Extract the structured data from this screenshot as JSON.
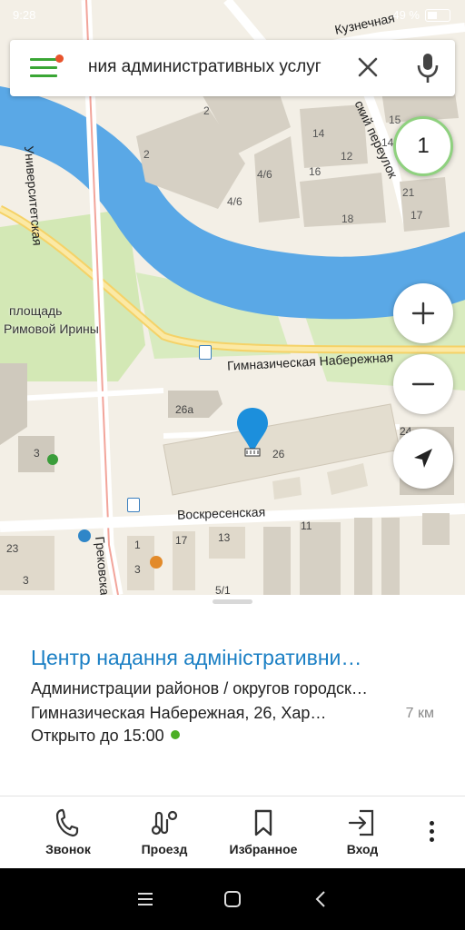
{
  "status_bar": {
    "time": "9:28",
    "battery": "49 %"
  },
  "search": {
    "query": "ния административных услуг"
  },
  "map": {
    "result_count": "1",
    "labels": {
      "square_line1": "площадь",
      "square_line2": "Римовой Ирины",
      "street_university": "Университетская",
      "street_embankment": "Гимназическая Набережная",
      "street_voskresenskaya": "Воскресенская",
      "street_grekovskaya": "Грековская",
      "street_kuznechnaya": "Кузнечная",
      "street_pereulok": "ский переулок",
      "top_partial": "площадь"
    },
    "house_numbers": [
      "2",
      "2",
      "4/6",
      "4/6",
      "16",
      "18",
      "14",
      "12",
      "15",
      "21",
      "17",
      "14",
      "26а",
      "26",
      "3",
      "23",
      "3",
      "1",
      "3",
      "17",
      "13",
      "11",
      "5/1",
      "24"
    ]
  },
  "place": {
    "title": "Центр надання адміністративни…",
    "category": "Администрации районов / округов городск…",
    "address": "Гимназическая Набережная, 26, Хар…",
    "distance": "7 км",
    "hours": "Открыто до 15:00"
  },
  "actions": [
    {
      "label": "Звонок",
      "icon": "phone-icon"
    },
    {
      "label": "Проезд",
      "icon": "route-icon"
    },
    {
      "label": "Избранное",
      "icon": "bookmark-icon"
    },
    {
      "label": "Вход",
      "icon": "entrance-icon"
    }
  ],
  "colors": {
    "accent_green": "#3aa635",
    "title_blue": "#1a7fc4",
    "river": "#5aa8e6",
    "open_dot": "#4caf24"
  }
}
